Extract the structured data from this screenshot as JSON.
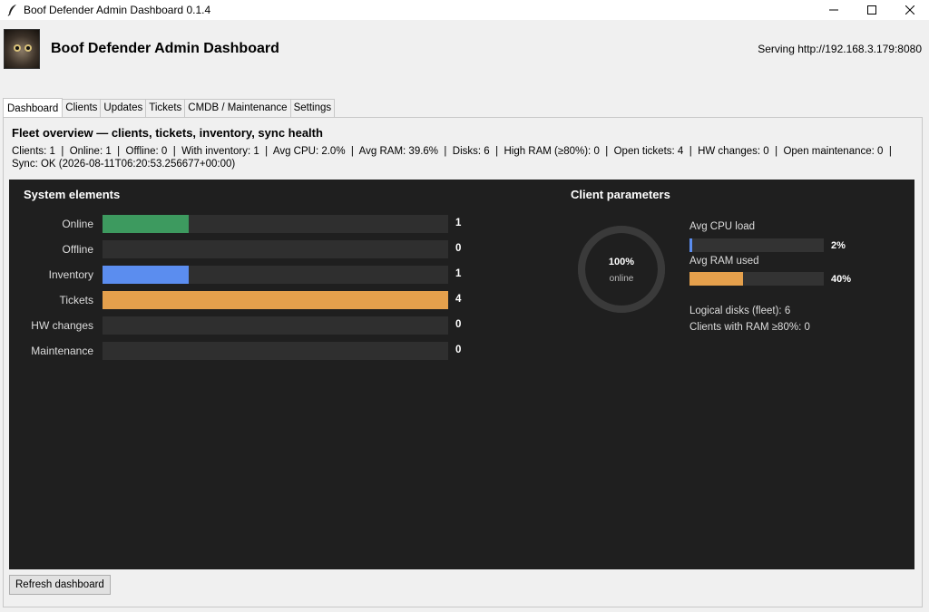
{
  "window": {
    "title": "Boof Defender Admin Dashboard 0.1.4"
  },
  "header": {
    "title": "Boof Defender Admin Dashboard",
    "serving": "Serving http://192.168.3.179:8080"
  },
  "tabs": [
    {
      "label": "Dashboard",
      "active": true
    },
    {
      "label": "Clients",
      "active": false
    },
    {
      "label": "Updates",
      "active": false
    },
    {
      "label": "Tickets",
      "active": false
    },
    {
      "label": "CMDB / Maintenance",
      "active": false
    },
    {
      "label": "Settings",
      "active": false
    }
  ],
  "overview": {
    "title": "Fleet overview — clients, tickets, inventory, sync health",
    "stats_line1": "Clients: 1  |  Online: 1  |  Offline: 0  |  With inventory: 1  |  Avg CPU: 2.0%  |  Avg RAM: 39.6%  |  Disks: 6  |  High RAM (≥80%): 0  |  Open tickets: 4  |  HW changes: 0  |  Open maintenance: 0  |",
    "stats_line2": "Sync: OK (2026-08-11T06:20:53.256677+00:00)"
  },
  "system_elements": {
    "title": "System elements",
    "max": 4,
    "items": [
      {
        "label": "Online",
        "value": "1",
        "count": 1,
        "color": "#3d9a5f"
      },
      {
        "label": "Offline",
        "value": "0",
        "count": 0,
        "color": "#3d9a5f"
      },
      {
        "label": "Inventory",
        "value": "1",
        "count": 1,
        "color": "#5b8def"
      },
      {
        "label": "Tickets",
        "value": "4",
        "count": 4,
        "color": "#e5a04c"
      },
      {
        "label": "HW changes",
        "value": "0",
        "count": 0,
        "color": "#888888"
      },
      {
        "label": "Maintenance",
        "value": "0",
        "count": 0,
        "color": "#888888"
      }
    ]
  },
  "client_parameters": {
    "title": "Client parameters",
    "ring": {
      "percent_text": "100%",
      "sub_text": "online",
      "fraction": 1.0
    },
    "cpu": {
      "label": "Avg CPU load",
      "value": "2%",
      "fraction": 0.02,
      "color": "#5b8def"
    },
    "ram": {
      "label": "Avg RAM used",
      "value": "40%",
      "fraction": 0.396,
      "color": "#e5a04c"
    },
    "logical_disks": "Logical disks (fleet): 6",
    "high_ram_clients": "Clients with RAM ≥80%: 0"
  },
  "buttons": {
    "refresh": "Refresh dashboard"
  }
}
